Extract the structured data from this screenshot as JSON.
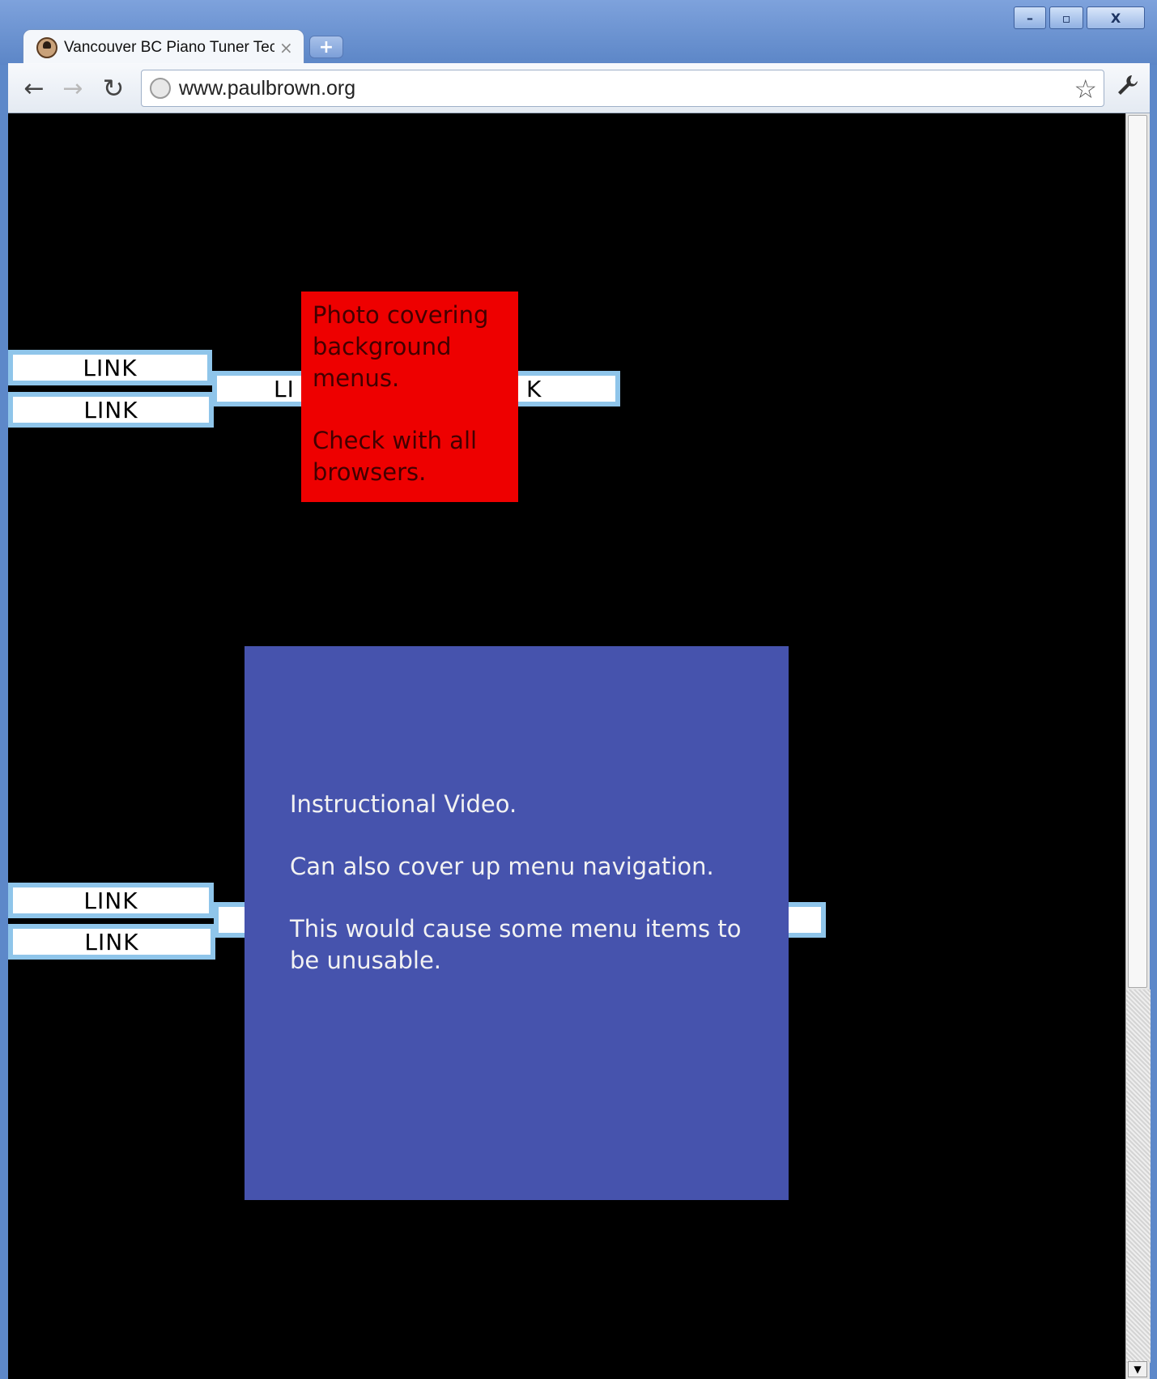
{
  "browser": {
    "tab_title": "Vancouver BC Piano Tuner Tec",
    "tab_close": "×",
    "new_tab": "+",
    "url": "www.paulbrown.org",
    "window_buttons": {
      "minimize": "–",
      "maximize": "▫",
      "close": "X"
    },
    "nav": {
      "back": "←",
      "forward": "→",
      "reload": "↻",
      "star": "☆",
      "wrench": "🔧"
    }
  },
  "page": {
    "links_top": {
      "left_upper": "LINK",
      "left_lower": "LINK",
      "center": "LI",
      "right": "K"
    },
    "links_bottom": {
      "left_upper": "LINK",
      "left_lower": "LINK"
    },
    "red_box": {
      "line1": "Photo covering background menus.",
      "line2": "Check with all browsers."
    },
    "blue_box": {
      "line1": "Instructional Video.",
      "line2": "Can also cover up menu navigation.",
      "line3": "This would cause some menu items to be unusable."
    }
  },
  "colors": {
    "page_background": "#000000",
    "link_border": "#8fc5ea",
    "red_box": "#ee0000",
    "blue_box": "#4653ad"
  },
  "icons": [
    "favicon-icon",
    "close-icon",
    "plus-icon",
    "back-icon",
    "forward-icon",
    "reload-icon",
    "globe-icon",
    "star-icon",
    "wrench-icon"
  ]
}
